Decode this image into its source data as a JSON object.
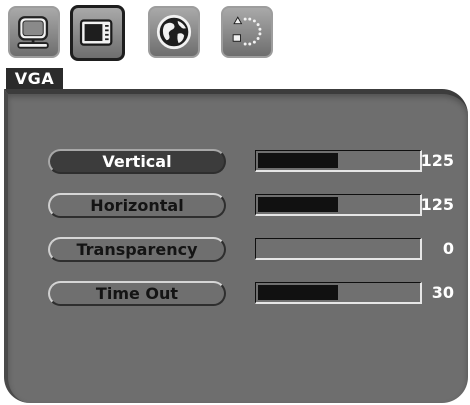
{
  "tabs": [
    {
      "icon": "monitor-icon",
      "selected": false
    },
    {
      "icon": "osd-settings-icon",
      "selected": true
    },
    {
      "icon": "globe-icon",
      "selected": false
    },
    {
      "icon": "misc-settings-icon",
      "selected": false
    }
  ],
  "source_label": "VGA",
  "settings": [
    {
      "label": "Vertical",
      "value": "125",
      "level": 0.5,
      "active": true
    },
    {
      "label": "Horizontal",
      "value": "125",
      "level": 0.5,
      "active": false
    },
    {
      "label": "Transparency",
      "value": "0",
      "level": 0,
      "active": false
    },
    {
      "label": "Time Out",
      "value": "30",
      "level": 0.5,
      "active": false
    }
  ],
  "colors": {
    "panel": "#6e6e6e",
    "bar_fill": "#111111",
    "active_pill": "#3c3c3c",
    "value_text": "#ffffff"
  }
}
